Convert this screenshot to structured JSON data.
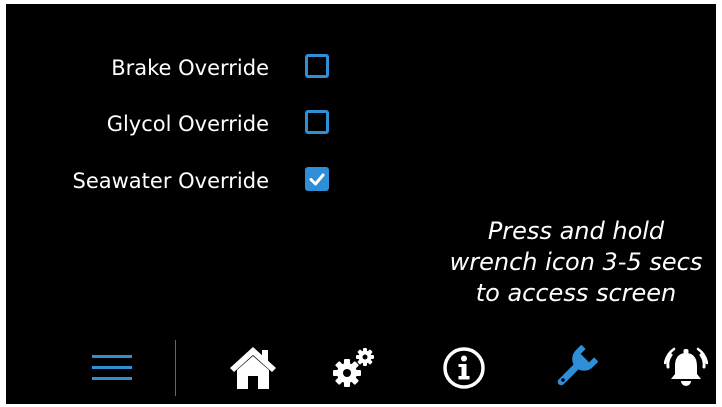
{
  "overrides": [
    {
      "label": "Brake Override",
      "checked": false
    },
    {
      "label": "Glycol Override",
      "checked": false
    },
    {
      "label": "Seawater Override",
      "checked": true
    }
  ],
  "hint": {
    "line1": "Press and hold",
    "line2": "wrench icon 3-5 secs",
    "line3": "to access screen"
  },
  "nav": {
    "items": [
      {
        "icon": "menu-icon",
        "active": true
      },
      {
        "icon": "home-icon",
        "active": false
      },
      {
        "icon": "gears-icon",
        "active": false
      },
      {
        "icon": "info-icon",
        "active": false
      },
      {
        "icon": "wrench-icon",
        "active": true
      },
      {
        "icon": "alarm-bell-icon",
        "active": false
      }
    ]
  },
  "colors": {
    "background": "#000000",
    "accent": "#2f8fd6",
    "text": "#ffffff"
  }
}
